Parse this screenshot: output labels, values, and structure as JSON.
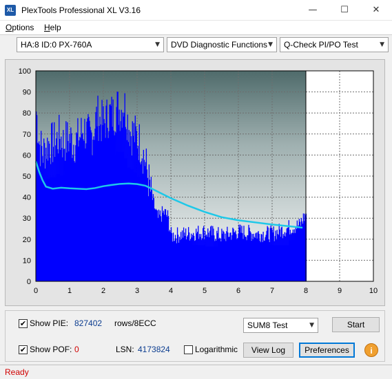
{
  "window": {
    "title": "PlexTools Professional XL V3.16",
    "icon_text": "XL",
    "minimize": "—",
    "maximize": "☐",
    "close": "✕"
  },
  "menu": {
    "options": "ptions",
    "options_key": "O",
    "help": "elp",
    "help_key": "H"
  },
  "toolbar": {
    "drive": "HA:8 ID:0  PX-760A",
    "function": "DVD Diagnostic Functions",
    "test": "Q-Check PI/PO Test",
    "arrow": "▼"
  },
  "chart_data": {
    "type": "bar",
    "title": "",
    "xlabel": "",
    "ylabel": "",
    "xlim": [
      0,
      10
    ],
    "ylim": [
      0,
      100
    ],
    "x_ticks": [
      "0",
      "1",
      "2",
      "3",
      "4",
      "5",
      "6",
      "7",
      "8",
      "9",
      "10"
    ],
    "y_ticks": [
      "0",
      "10",
      "20",
      "30",
      "40",
      "50",
      "60",
      "70",
      "80",
      "90",
      "100"
    ],
    "grid": true,
    "data_end_x": 8,
    "colors": {
      "bars": "#0000ff",
      "line": "#1ec8e8",
      "background_top": "#4f6b6b",
      "background_bottom": "#ffffff"
    },
    "series": [
      {
        "name": "PIE",
        "type": "bar",
        "x": [
          0,
          0.1,
          0.2,
          0.3,
          0.4,
          0.5,
          0.6,
          0.7,
          0.8,
          0.9,
          1.0,
          1.1,
          1.2,
          1.3,
          1.4,
          1.5,
          1.6,
          1.7,
          1.8,
          1.9,
          2.0,
          2.1,
          2.2,
          2.3,
          2.4,
          2.5,
          2.6,
          2.7,
          2.8,
          2.9,
          3.0,
          3.1,
          3.2,
          3.3,
          3.4,
          3.5,
          3.6,
          3.7,
          3.8,
          3.9,
          4.0,
          4.5,
          5.0,
          5.5,
          6.0,
          6.5,
          7.0,
          7.5,
          7.8,
          8.0
        ],
        "values": [
          82,
          66,
          62,
          65,
          67,
          66,
          68,
          70,
          67,
          68,
          69,
          67,
          68,
          70,
          74,
          71,
          69,
          73,
          80,
          77,
          76,
          79,
          81,
          80,
          84,
          82,
          86,
          78,
          72,
          71,
          69,
          66,
          60,
          52,
          42,
          36,
          30,
          32,
          33,
          31,
          22,
          23,
          24,
          22,
          24,
          23,
          23,
          26,
          27,
          33
        ]
      },
      {
        "name": "Total",
        "type": "line",
        "x": [
          0,
          0.1,
          0.2,
          0.3,
          0.4,
          0.5,
          0.75,
          1.0,
          1.25,
          1.5,
          1.75,
          2.0,
          2.25,
          2.5,
          2.75,
          3.0,
          3.25,
          3.5,
          3.75,
          4.0,
          4.5,
          5.0,
          5.5,
          6.0,
          6.5,
          7.0,
          7.5,
          7.9
        ],
        "values": [
          57,
          52,
          48,
          45,
          44.5,
          44,
          44.5,
          44.2,
          44,
          43.8,
          44.3,
          45.2,
          45.8,
          46.3,
          46.5,
          46.2,
          45.4,
          43.5,
          41.5,
          39.5,
          36,
          33,
          30.5,
          29,
          28,
          27,
          26.2,
          25.5
        ]
      }
    ]
  },
  "controls": {
    "show_pie_label": "Show PIE:",
    "show_pie_checked": "✔",
    "pie_value": "827402",
    "rows_unit": "rows/8ECC",
    "show_pof_label": "Show POF:",
    "show_pof_checked": "✔",
    "pof_value": "0",
    "lsn_label": "LSN:",
    "lsn_value": "4173824",
    "logarithmic_label": "Logarithmic",
    "test_mode": "SUM8 Test",
    "start": "Start",
    "view_log": "View Log",
    "preferences": "Preferences",
    "info": "i"
  },
  "status": {
    "text": "Ready"
  }
}
